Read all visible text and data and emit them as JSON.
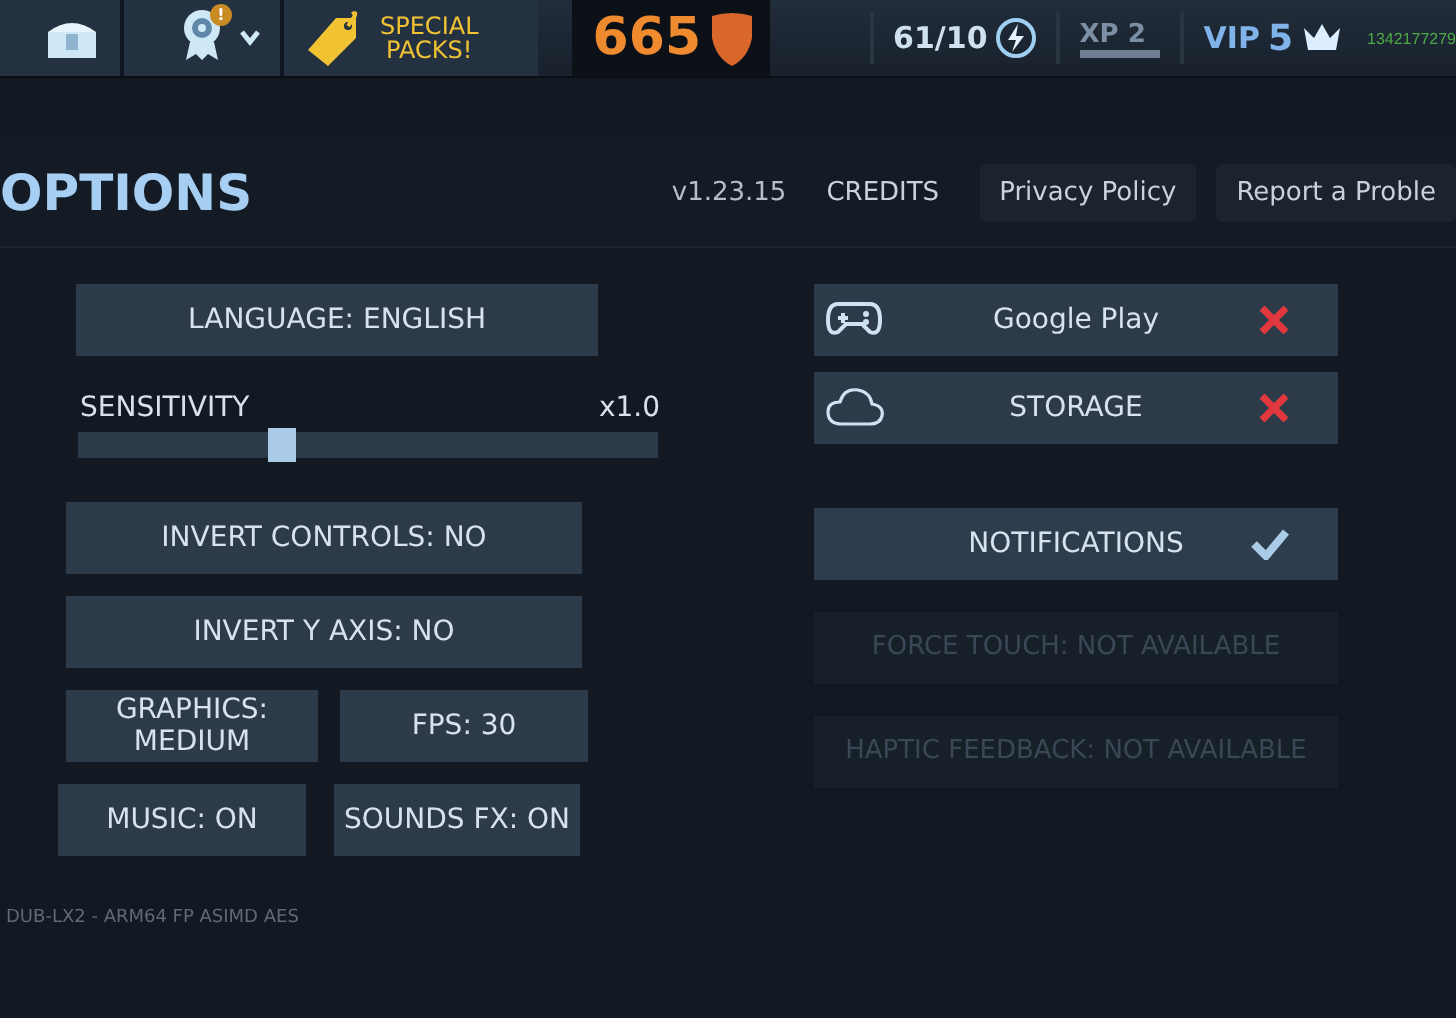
{
  "top_bar": {
    "special_packs": "SPECIAL\nPACKS!",
    "alert_badge": "!",
    "trophies": "665",
    "energy": "61/10",
    "xp": {
      "label": "XP 2",
      "level": 1
    },
    "vip": {
      "label": "VIP",
      "value": "5"
    },
    "player_id": "1342177279"
  },
  "header": {
    "title": "OPTIONS",
    "version": "v1.23.15",
    "links": [
      {
        "label": "CREDITS",
        "kind": "plain"
      },
      {
        "label": "Privacy Policy",
        "kind": "boxed"
      },
      {
        "label": "Report a Proble",
        "kind": "boxed"
      }
    ]
  },
  "left": {
    "language": "LANGUAGE: ENGLISH",
    "sensitivity": {
      "label": "SENSITIVITY",
      "reading": "x1.0",
      "level": 0.35
    },
    "rows": [
      [
        "INVERT CONTROLS: NO"
      ],
      [
        "INVERT Y AXIS: NO"
      ],
      [
        "GRAPHICS:\nMEDIUM",
        "FPS: 30"
      ],
      [
        "MUSIC: ON",
        "SOUNDS FX: ON"
      ]
    ]
  },
  "right": [
    {
      "label": "Google Play",
      "kind": "account",
      "on": false,
      "disabled": false
    },
    {
      "label": "STORAGE",
      "kind": "account",
      "on": false,
      "disabled": false
    },
    {
      "label": "NOTIFICATIONS",
      "kind": "toggle",
      "on": true,
      "disabled": false
    },
    {
      "label": "FORCE TOUCH: NOT AVAILABLE",
      "kind": "toggle",
      "disabled": true
    },
    {
      "label": "HAPTIC FEEDBACK: NOT AVAILABLE",
      "kind": "toggle",
      "disabled": true
    }
  ],
  "footer": "DUB-LX2 - ARM64 FP ASIMD AES"
}
